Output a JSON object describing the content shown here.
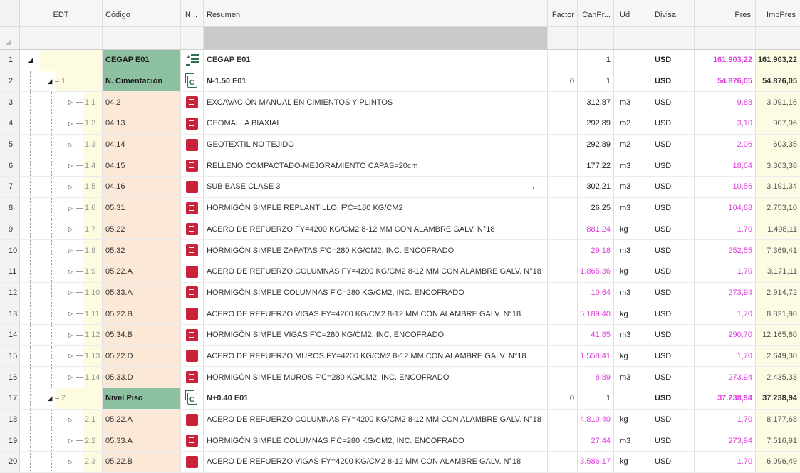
{
  "columns": {
    "edt": "EDT",
    "codigo": "Código",
    "n": "N...",
    "resumen": "Resumen",
    "factor": "Factor",
    "canpres": "CanPr...",
    "ud": "Ud",
    "divisa": "Divisa",
    "pres": "Pres",
    "imppres": "ImpPres"
  },
  "colors": {
    "chapter_code_bg": "#8cc0a0",
    "code_bg": "#fbe8d6",
    "price_text": "#e040e0",
    "imp_bg": "#fcfce4",
    "partida_icon": "#c8233a"
  },
  "rows": [
    {
      "idx": "1",
      "level": 0,
      "edt": "",
      "codigo": "CEGAP E01",
      "icon": "root-icon",
      "resumen": "CEGAP E01",
      "factor": "",
      "canpres": "1",
      "ud": "",
      "divisa": "USD",
      "pres": "161.903,22",
      "imppres": "161.903,22",
      "chap": true
    },
    {
      "idx": "2",
      "level": 1,
      "edt": "1",
      "codigo": "N. Cimentación",
      "icon": "chapter-icon",
      "resumen": "N-1.50 E01",
      "factor": "0",
      "canpres": "1",
      "ud": "",
      "divisa": "USD",
      "pres": "54.876,05",
      "imppres": "54.876,05",
      "chap": true
    },
    {
      "idx": "3",
      "level": 2,
      "edt": "1.1",
      "codigo": "04.2",
      "icon": "partida-icon",
      "resumen": "EXCAVACIÓN MANUAL EN CIMIENTOS Y PLINTOS",
      "factor": "",
      "canpres": "312,87",
      "ud": "m3",
      "divisa": "USD",
      "pres": "9,88",
      "imppres": "3.091,16"
    },
    {
      "idx": "4",
      "level": 2,
      "edt": "1.2",
      "codigo": "04.13",
      "icon": "partida-icon",
      "resumen": "GEOMALLA BIAXIAL",
      "factor": "",
      "canpres": "292,89",
      "ud": "m2",
      "divisa": "USD",
      "pres": "3,10",
      "imppres": "907,96"
    },
    {
      "idx": "5",
      "level": 2,
      "edt": "1.3",
      "codigo": "04.14",
      "icon": "partida-icon",
      "resumen": "GEOTEXTIL NO TEJIDO",
      "factor": "",
      "canpres": "292,89",
      "ud": "m2",
      "divisa": "USD",
      "pres": "2,06",
      "imppres": "603,35"
    },
    {
      "idx": "6",
      "level": 2,
      "edt": "1.4",
      "codigo": "04.15",
      "icon": "partida-icon",
      "resumen": "RELLENO COMPACTADO-MEJORAMIENTO CAPAS=20cm",
      "factor": "",
      "canpres": "177,22",
      "ud": "m3",
      "divisa": "USD",
      "pres": "18,64",
      "imppres": "3.303,38"
    },
    {
      "idx": "7",
      "level": 2,
      "edt": "1.5",
      "codigo": "04.16",
      "icon": "partida-icon",
      "resumen": "SUB BASE CLASE 3",
      "factor": "",
      "canpres": "302,21",
      "ud": "m3",
      "divisa": "USD",
      "pres": "10,56",
      "imppres": "3.191,34"
    },
    {
      "idx": "8",
      "level": 2,
      "edt": "1.6",
      "codigo": "05.31",
      "icon": "partida-icon",
      "resumen": "HORMIGÓN SIMPLE REPLANTILLO, F'C=180 KG/CM2",
      "factor": "",
      "canpres": "26,25",
      "ud": "m3",
      "divisa": "USD",
      "pres": "104,88",
      "imppres": "2.753,10"
    },
    {
      "idx": "9",
      "level": 2,
      "edt": "1.7",
      "codigo": "05.22",
      "icon": "partida-icon",
      "resumen": "ACERO DE REFUERZO FY=4200 KG/CM2 8-12 MM CON ALAMBRE GALV. N°18",
      "factor": "",
      "canpres": "881,24",
      "ud": "kg",
      "divisa": "USD",
      "pres": "1,70",
      "imppres": "1.498,11",
      "pinkcan": true
    },
    {
      "idx": "10",
      "level": 2,
      "edt": "1.8",
      "codigo": "05.32",
      "icon": "partida-icon",
      "resumen": "HORMIGÓN SIMPLE ZAPATAS  F'C=280 KG/CM2, INC. ENCOFRADO",
      "factor": "",
      "canpres": "29,18",
      "ud": "m3",
      "divisa": "USD",
      "pres": "252,55",
      "imppres": "7.369,41",
      "pinkcan": true
    },
    {
      "idx": "11",
      "level": 2,
      "edt": "1.9",
      "codigo": "05.22.A",
      "icon": "partida-icon",
      "resumen": "ACERO DE REFUERZO COLUMNAS FY=4200 KG/CM2 8-12 MM CON ALAMBRE GALV. N°18",
      "factor": "",
      "canpres": "1.865,36",
      "ud": "kg",
      "divisa": "USD",
      "pres": "1,70",
      "imppres": "3.171,11",
      "pinkcan": true
    },
    {
      "idx": "12",
      "level": 2,
      "edt": "1.10",
      "codigo": "05.33.A",
      "icon": "partida-icon",
      "resumen": "HORMIGÓN SIMPLE COLUMNAS F'C=280 KG/CM2, INC. ENCOFRADO",
      "factor": "",
      "canpres": "10,64",
      "ud": "m3",
      "divisa": "USD",
      "pres": "273,94",
      "imppres": "2.914,72",
      "pinkcan": true
    },
    {
      "idx": "13",
      "level": 2,
      "edt": "1.11",
      "codigo": "05.22.B",
      "icon": "partida-icon",
      "resumen": "ACERO DE REFUERZO VIGAS FY=4200 KG/CM2 8-12 MM CON ALAMBRE GALV. N°18",
      "factor": "",
      "canpres": "5.189,40",
      "ud": "kg",
      "divisa": "USD",
      "pres": "1,70",
      "imppres": "8.821,98",
      "pinkcan": true
    },
    {
      "idx": "14",
      "level": 2,
      "edt": "1.12",
      "codigo": "05.34.B",
      "icon": "partida-icon",
      "resumen": "HORMIGÓN SIMPLE VIGAS  F'C=280 KG/CM2, INC. ENCOFRADO",
      "factor": "",
      "canpres": "41,85",
      "ud": "m3",
      "divisa": "USD",
      "pres": "290,70",
      "imppres": "12.165,80",
      "pinkcan": true
    },
    {
      "idx": "15",
      "level": 2,
      "edt": "1.13",
      "codigo": "05.22.D",
      "icon": "partida-icon",
      "resumen": "ACERO DE REFUERZO MUROS FY=4200 KG/CM2 8-12 MM CON ALAMBRE GALV. N°18",
      "factor": "",
      "canpres": "1.558,41",
      "ud": "kg",
      "divisa": "USD",
      "pres": "1,70",
      "imppres": "2.649,30",
      "pinkcan": true
    },
    {
      "idx": "16",
      "level": 2,
      "edt": "1.14",
      "codigo": "05.33.D",
      "icon": "partida-icon",
      "resumen": "HORMIGÓN SIMPLE MUROS  F'C=280 KG/CM2, INC. ENCOFRADO",
      "factor": "",
      "canpres": "8,89",
      "ud": "m3",
      "divisa": "USD",
      "pres": "273,94",
      "imppres": "2.435,33",
      "pinkcan": true
    },
    {
      "idx": "17",
      "level": 1,
      "edt": "2",
      "codigo": "Nivel Piso",
      "icon": "chapter-icon",
      "resumen": "N+0.40 E01",
      "factor": "0",
      "canpres": "1",
      "ud": "",
      "divisa": "USD",
      "pres": "37.238,94",
      "imppres": "37.238,94",
      "chap": true
    },
    {
      "idx": "18",
      "level": 2,
      "edt": "2.1",
      "codigo": "05.22.A",
      "icon": "partida-icon",
      "resumen": "ACERO DE REFUERZO COLUMNAS FY=4200 KG/CM2 8-12 MM CON ALAMBRE GALV. N°18",
      "factor": "",
      "canpres": "4.810,40",
      "ud": "kg",
      "divisa": "USD",
      "pres": "1,70",
      "imppres": "8.177,68",
      "pinkcan": true
    },
    {
      "idx": "19",
      "level": 2,
      "edt": "2.2",
      "codigo": "05.33.A",
      "icon": "partida-icon",
      "resumen": "HORMIGÓN SIMPLE COLUMNAS F'C=280 KG/CM2, INC. ENCOFRADO",
      "factor": "",
      "canpres": "27,44",
      "ud": "m3",
      "divisa": "USD",
      "pres": "273,94",
      "imppres": "7.516,91",
      "pinkcan": true
    },
    {
      "idx": "20",
      "level": 2,
      "edt": "2.3",
      "codigo": "05.22.B",
      "icon": "partida-icon",
      "resumen": "ACERO DE REFUERZO VIGAS FY=4200 KG/CM2 8-12 MM CON ALAMBRE GALV. N°18",
      "factor": "",
      "canpres": "3.586,17",
      "ud": "kg",
      "divisa": "USD",
      "pres": "1,70",
      "imppres": "6.096,49",
      "pinkcan": true
    }
  ]
}
